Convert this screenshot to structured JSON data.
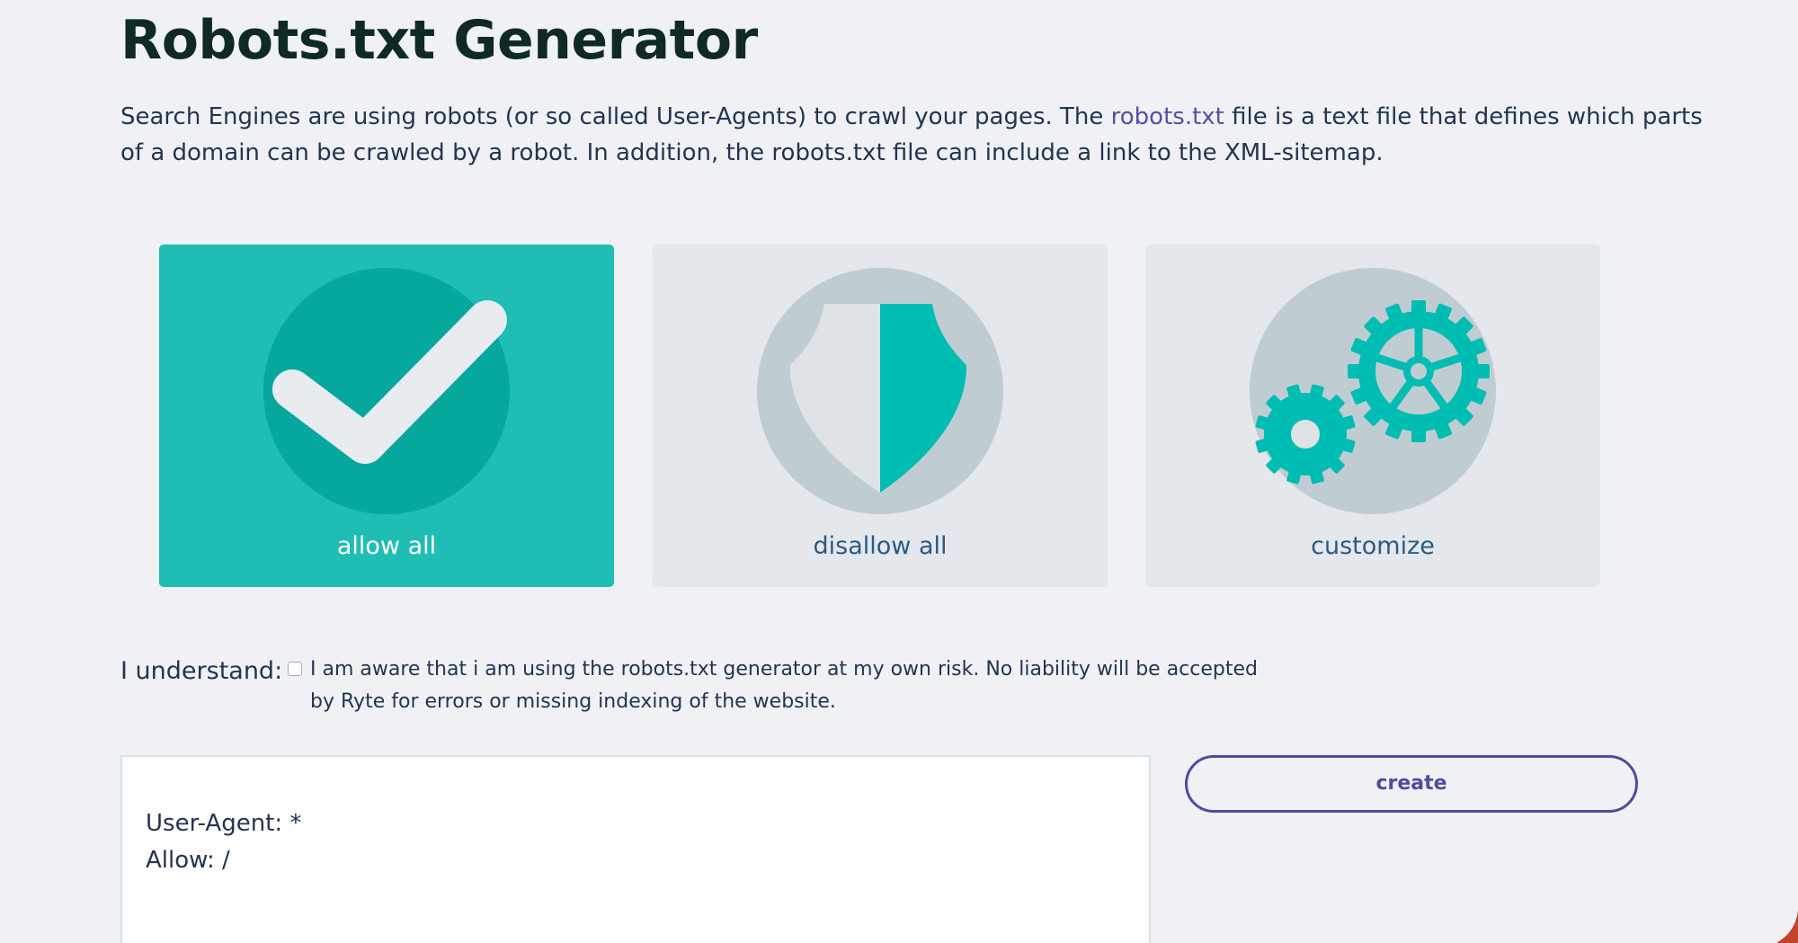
{
  "header": {
    "title": "Robots.txt Generator"
  },
  "intro": {
    "text_before_link": "Search Engines are using robots (or so called User-Agents) to crawl your pages. The ",
    "link_text": "robots.txt",
    "text_after_link": " file is a text file that defines which parts of a domain can be crawled by a robot. In addition, the robots.txt file can include a link to the XML-sitemap."
  },
  "options": {
    "selected": "allow all",
    "items": [
      {
        "label": "allow all",
        "icon": "checkmark-icon"
      },
      {
        "label": "disallow all",
        "icon": "shield-icon"
      },
      {
        "label": "customize",
        "icon": "gears-icon"
      }
    ]
  },
  "consent": {
    "label": "I understand:",
    "checked": false,
    "text": "I am aware that i am using the robots.txt generator at my own risk. No liability will be accepted by Ryte for errors or missing indexing of the website."
  },
  "output": {
    "lines": [
      "User-Agent: *",
      "Allow: /"
    ]
  },
  "actions": {
    "create_label": "create"
  },
  "colors": {
    "page_background": "#eff1f5",
    "accent_teal": "#1fbdb4",
    "teal_dark": "#06a89e",
    "icon_gray": "#bfcdd3",
    "card_background": "#e4e7ec",
    "button_purple": "#4e4ba0",
    "link_purple": "#574fa3",
    "title_color": "#0f2a25",
    "text_color": "#233550",
    "label_blue": "#2a5b85"
  }
}
